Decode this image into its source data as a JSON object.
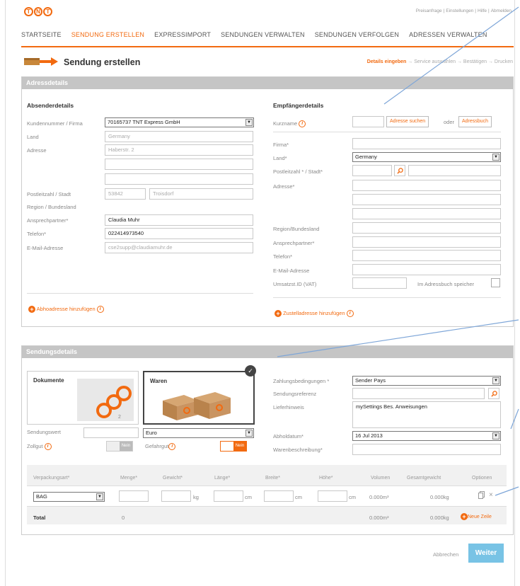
{
  "header": {
    "logo": "TNT",
    "top_links": [
      "Preisanfrage",
      "Einstellungen",
      "Hilfe",
      "Abmelden"
    ],
    "nav": [
      "STARTSEITE",
      "SENDUNG ERSTELLEN",
      "EXPRESSIMPORT",
      "SENDUNGEN VERWALTEN",
      "SENDUNGEN VERFOLGEN",
      "ADRESSEN VERWALTEN"
    ],
    "active_nav": "SENDUNG ERSTELLEN"
  },
  "page": {
    "title": "Sendung erstellen",
    "steps": [
      "Details eingeben",
      "Service auswählen",
      "Bestätigen",
      "Drucken"
    ]
  },
  "address": {
    "section_title": "Adressdetails",
    "sender": {
      "title": "Absenderdetails",
      "customer_label": "Kundennummer / Firma",
      "customer_value": "70165737 TNT Express GmbH",
      "country_label": "Land",
      "country_value": "Germany",
      "address_label": "Adresse",
      "address_value": "Haberstr. 2",
      "zip_city_label": "Postleitzahl / Stadt",
      "zip_value": "53842",
      "city_value": "Troisdorf",
      "region_label": "Region / Bundesland",
      "contact_label": "Ansprechpartner*",
      "contact_value": "Claudia Muhr",
      "phone_label": "Telefon*",
      "phone_value": "022414973540",
      "email_label": "E-Mail-Adresse",
      "email_value": "cse2supp@claudiamuhr.de",
      "add_pickup": "Abhoadresse hinzufügen"
    },
    "recipient": {
      "title": "Empfängerdetails",
      "shortname_label": "Kurzname",
      "search_button": "Adresse suchen",
      "or_text": "oder",
      "addressbook_button": "Adressbuch",
      "company_label": "Firma*",
      "country_label": "Land*",
      "country_value": "Germany",
      "zip_city_label": "Postleitzahl * / Stadt*",
      "address_label": "Adresse*",
      "region_label": "Region/Bundesland",
      "contact_label": "Ansprechpartner*",
      "phone_label": "Telefon*",
      "email_label": "E-Mail-Adresse",
      "vat_label": "Umsatzst.ID (VAT)",
      "save_label": "Im Adressbuch speicher",
      "add_delivery": "Zustelladresse hinzufügen"
    }
  },
  "shipment": {
    "section_title": "Sendungsdetails",
    "doc_card": "Dokumente",
    "goods_card": "Waren",
    "value_label": "Sendungswert",
    "currency_value": "Euro",
    "customs_label": "Zollgut",
    "customs_toggle": "Nein",
    "dangerous_label": "Gefahrgut",
    "dangerous_toggle": "Nein",
    "payment_label": "Zahlungsbedingungen *",
    "payment_value": "Sender Pays",
    "reference_label": "Sendungsreferenz",
    "delivery_note_label": "Lieferhinweis",
    "delivery_note_value": "mySettings Bes. Anweisungen",
    "pickup_date_label": "Abholdatum*",
    "pickup_date_value": "16 Jul 2013",
    "goods_desc_label": "Warenbeschreibung*"
  },
  "packages": {
    "headers": [
      "Verpackungsart*",
      "Menge*",
      "Gewicht*",
      "Länge*",
      "Breite*",
      "Höhe*",
      "Volumen",
      "Gesamtgewicht",
      "Optionen"
    ],
    "row": {
      "type": "BAG",
      "kg": "kg",
      "cm1": "cm",
      "cm2": "cm",
      "cm3": "cm",
      "volume": "0.000m³",
      "weight": "0.000kg"
    },
    "total": {
      "label": "Total",
      "qty": "0",
      "volume": "0.000m³",
      "weight": "0.000kg"
    },
    "new_row": "Neue Zeile"
  },
  "footer": {
    "cancel": "Abbrechen",
    "next": "Weiter"
  },
  "colors": {
    "accent": "#f26a10",
    "section_header": "#c5c5c5",
    "next_button": "#78c3e5"
  }
}
